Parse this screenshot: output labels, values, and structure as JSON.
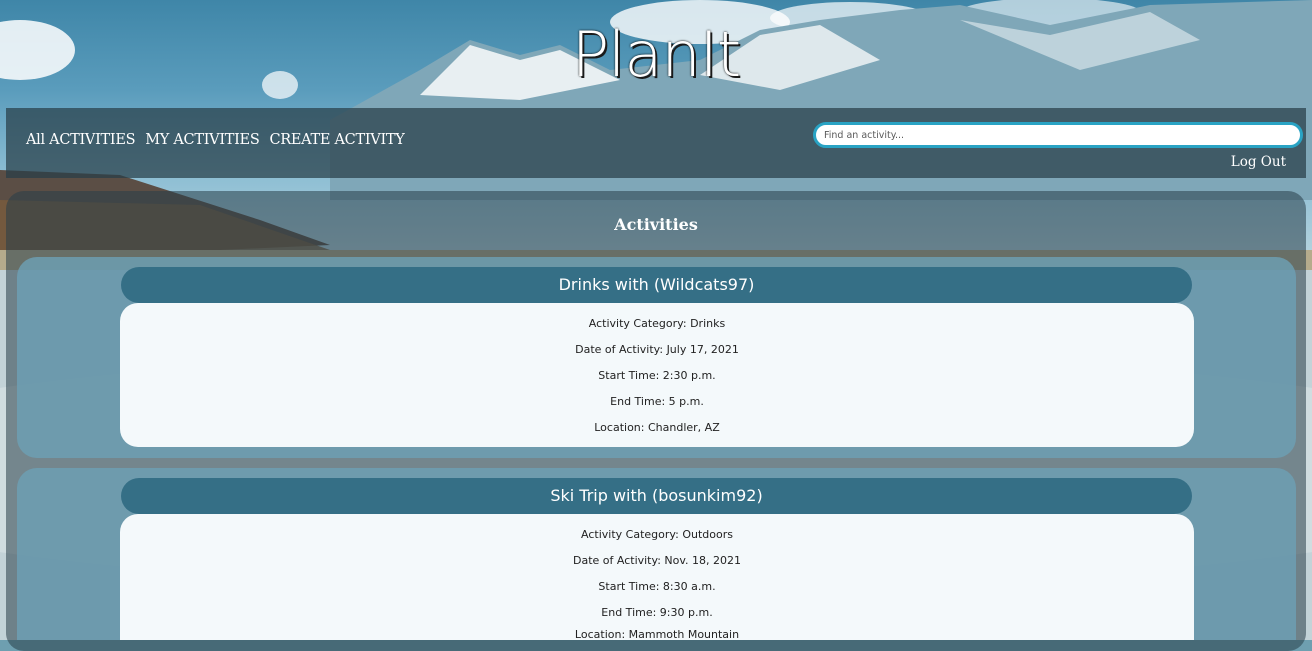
{
  "site": {
    "title": "PlanIt"
  },
  "nav": {
    "links": [
      "All ACTIVITIES",
      "MY ACTIVITIES",
      "CREATE ACTIVITY"
    ],
    "search_placeholder": "Find an activity...",
    "logout_label": "Log Out"
  },
  "section": {
    "title": "Activities"
  },
  "activities": [
    {
      "title": "Drinks with (Wildcats97)",
      "category": "Activity Category: Drinks",
      "date": "Date of Activity: July 17, 2021",
      "start": "Start Time: 2:30 p.m.",
      "end": "End Time: 5 p.m.",
      "location": "Location: Chandler, AZ"
    },
    {
      "title": "Ski Trip with (bosunkim92)",
      "category": "Activity Category: Outdoors",
      "date": "Date of Activity: Nov. 18, 2021",
      "start": "Start Time: 8:30 a.m.",
      "end": "End Time: 9:30 p.m.",
      "location": "Location: Mammoth Mountain"
    }
  ],
  "colors": {
    "accent": "#29a3c4",
    "card_header": "#356f86",
    "nav_bg": "#283e48"
  }
}
